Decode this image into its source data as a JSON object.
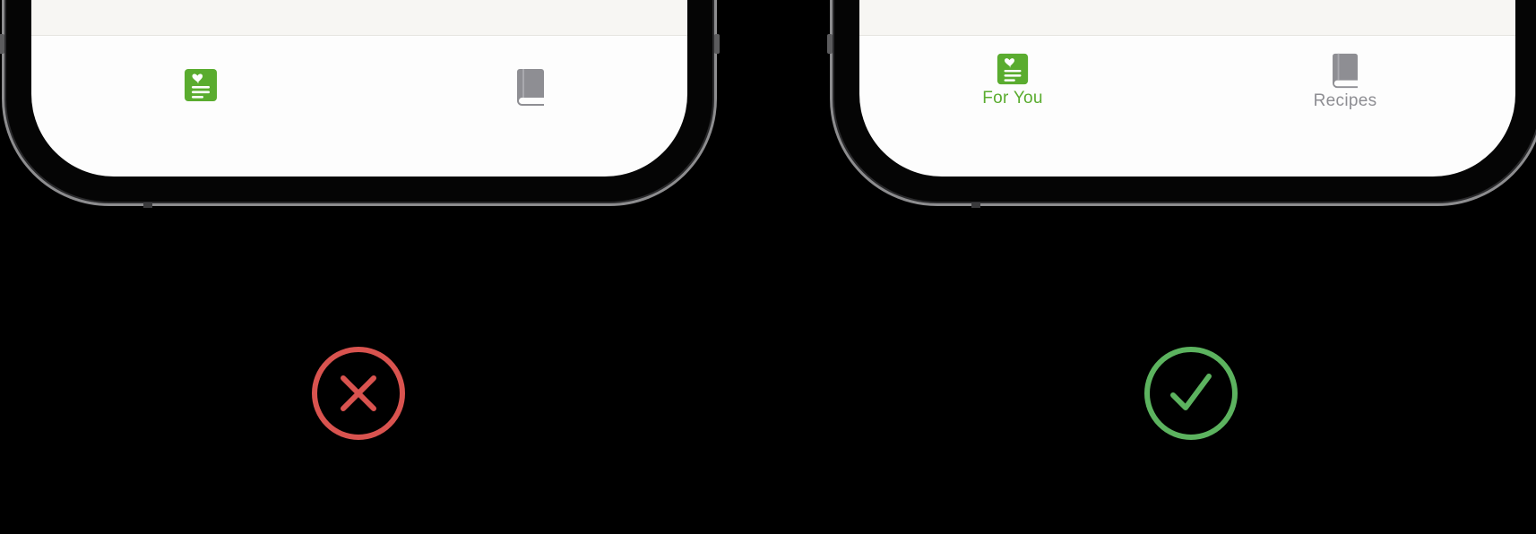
{
  "colors": {
    "background": "#000000",
    "selected_tint": "#5aac2f",
    "unselected_tint": "#8e8e93",
    "wrong_mark": "#d9534f",
    "right_mark": "#5cb35f"
  },
  "left_example": {
    "verdict_icon": "x-circle-icon",
    "tabs": [
      {
        "icon": "for-you-icon",
        "label": "",
        "selected": true
      },
      {
        "icon": "book-icon",
        "label": "",
        "selected": false
      }
    ]
  },
  "right_example": {
    "verdict_icon": "checkmark-circle-icon",
    "tabs": [
      {
        "icon": "for-you-icon",
        "label": "For You",
        "selected": true
      },
      {
        "icon": "book-icon",
        "label": "Recipes",
        "selected": false
      }
    ]
  }
}
